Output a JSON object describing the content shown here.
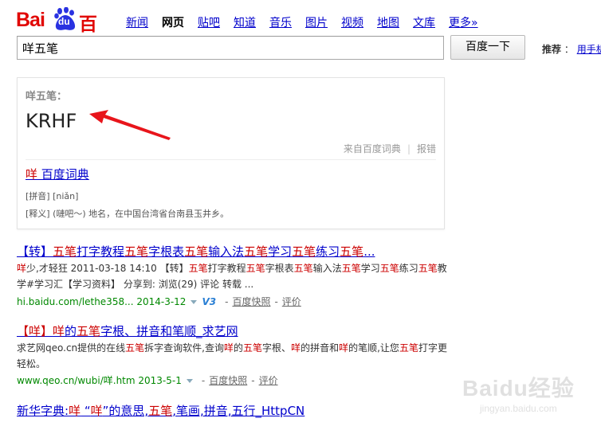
{
  "logo": {
    "bai": "Bai",
    "du": "du",
    "cn": "百度"
  },
  "nav": [
    {
      "label": "新闻",
      "active": false
    },
    {
      "label": "网页",
      "active": true
    },
    {
      "label": "贴吧",
      "active": false
    },
    {
      "label": "知道",
      "active": false
    },
    {
      "label": "音乐",
      "active": false
    },
    {
      "label": "图片",
      "active": false
    },
    {
      "label": "视频",
      "active": false
    },
    {
      "label": "地图",
      "active": false
    },
    {
      "label": "文库",
      "active": false
    },
    {
      "label": "更多»",
      "active": false
    }
  ],
  "search": {
    "value": "咩五笔",
    "button": "百度一下"
  },
  "recommend": {
    "label": "推荐",
    "colon": "：",
    "link": "用手机"
  },
  "card": {
    "label": "咩五笔：",
    "code": "KRHF",
    "source": "来自百度词典",
    "separator": "|",
    "report": "报错",
    "dict_char": "咩",
    "dict_rest": " 百度词典",
    "pinyin": "[拼音] [niǎn]",
    "meaning": "[释义] (嗹吧～) 地名，在中国台湾省台南县玉井乡。"
  },
  "results": [
    {
      "title_parts": [
        {
          "t": "【转】",
          "em": false
        },
        {
          "t": "五笔",
          "em": true
        },
        {
          "t": "打字教程",
          "em": false
        },
        {
          "t": "五笔",
          "em": true
        },
        {
          "t": "字根表",
          "em": false
        },
        {
          "t": "五笔",
          "em": true
        },
        {
          "t": "输入法",
          "em": false
        },
        {
          "t": "五笔",
          "em": true
        },
        {
          "t": "学习",
          "em": false
        },
        {
          "t": "五笔",
          "em": true
        },
        {
          "t": "练习",
          "em": false
        },
        {
          "t": "五笔",
          "em": true
        },
        {
          "t": "...",
          "em": false
        }
      ],
      "snippet_parts": [
        {
          "t": "咩",
          "em": true
        },
        {
          "t": "少,才轻狂 2011-03-18 14:10 【转】",
          "em": false
        },
        {
          "t": "五笔",
          "em": true
        },
        {
          "t": "打字教程",
          "em": false
        },
        {
          "t": "五笔",
          "em": true
        },
        {
          "t": "字根表",
          "em": false
        },
        {
          "t": "五笔",
          "em": true
        },
        {
          "t": "输入法",
          "em": false
        },
        {
          "t": "五笔",
          "em": true
        },
        {
          "t": "学习",
          "em": false
        },
        {
          "t": "五笔",
          "em": true
        },
        {
          "t": "练习",
          "em": false
        },
        {
          "t": "五笔",
          "em": true
        },
        {
          "t": "教学#学习汇【学习资料】 分享到: 浏览(29) 评论 转载 ...",
          "em": false
        }
      ],
      "url": "hi.baidu.com/lethe358... 2014-3-12",
      "v3": "V3",
      "cache": "百度快照",
      "rate": "评价"
    },
    {
      "title_parts": [
        {
          "t": "【咩】",
          "em": true
        },
        {
          "t": "咩",
          "em": true
        },
        {
          "t": "的",
          "em": false
        },
        {
          "t": "五笔",
          "em": true
        },
        {
          "t": "字根、拼音和笔顺_求艺网",
          "em": false
        }
      ],
      "snippet_parts": [
        {
          "t": "求艺网qeo.cn提供的在线",
          "em": false
        },
        {
          "t": "五笔",
          "em": true
        },
        {
          "t": "拆字查询软件,查询",
          "em": false
        },
        {
          "t": "咩",
          "em": true
        },
        {
          "t": "的",
          "em": false
        },
        {
          "t": "五笔",
          "em": true
        },
        {
          "t": "字根、",
          "em": false
        },
        {
          "t": "咩",
          "em": true
        },
        {
          "t": "的拼音和",
          "em": false
        },
        {
          "t": "咩",
          "em": true
        },
        {
          "t": "的笔顺,让您",
          "em": false
        },
        {
          "t": "五笔",
          "em": true
        },
        {
          "t": "打字更轻松。",
          "em": false
        }
      ],
      "url": "www.qeo.cn/wubi/咩.htm 2013-5-1",
      "cache": "百度快照",
      "rate": "评价"
    },
    {
      "title_parts": [
        {
          "t": "新华字典:",
          "em": false
        },
        {
          "t": "咩",
          "em": true
        },
        {
          "t": " “",
          "em": false
        },
        {
          "t": "咩",
          "em": true
        },
        {
          "t": "”的意思,",
          "em": false
        },
        {
          "t": "五笔",
          "em": true
        },
        {
          "t": ",笔画,拼音,五行_HttpCN",
          "em": false
        }
      ]
    }
  ],
  "watermark": {
    "logo": "Baidu经验",
    "sub": "jingyan.baidu.com"
  }
}
